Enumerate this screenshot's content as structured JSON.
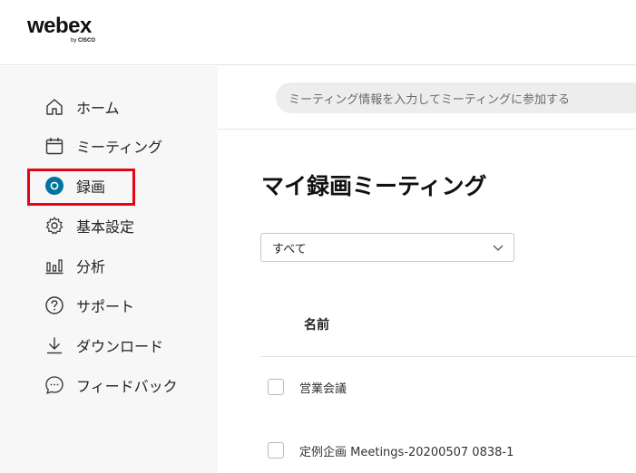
{
  "header": {
    "logo_text": "webex",
    "logo_by": "by",
    "logo_cisco": "CISCO"
  },
  "sidebar": {
    "items": [
      {
        "label": "ホーム",
        "icon": "home-icon"
      },
      {
        "label": "ミーティング",
        "icon": "calendar-icon"
      },
      {
        "label": "録画",
        "icon": "record-icon",
        "active": true
      },
      {
        "label": "基本設定",
        "icon": "gear-icon"
      },
      {
        "label": "分析",
        "icon": "bar-chart-icon"
      },
      {
        "label": "サポート",
        "icon": "help-icon"
      },
      {
        "label": "ダウンロード",
        "icon": "download-icon"
      },
      {
        "label": "フィードバック",
        "icon": "chat-bubble-icon"
      }
    ]
  },
  "search": {
    "placeholder": "ミーティング情報を入力してミーティングに参加する"
  },
  "main": {
    "title": "マイ録画ミーティング",
    "filter_value": "すべて",
    "column_name": "名前",
    "rows": [
      {
        "name": "営業会議"
      },
      {
        "name": "定例企画 Meetings-20200507 0838-1"
      }
    ]
  },
  "colors": {
    "accent": "#00749e",
    "highlight": "#e40612",
    "sidebar_bg": "#f7f7f7"
  }
}
